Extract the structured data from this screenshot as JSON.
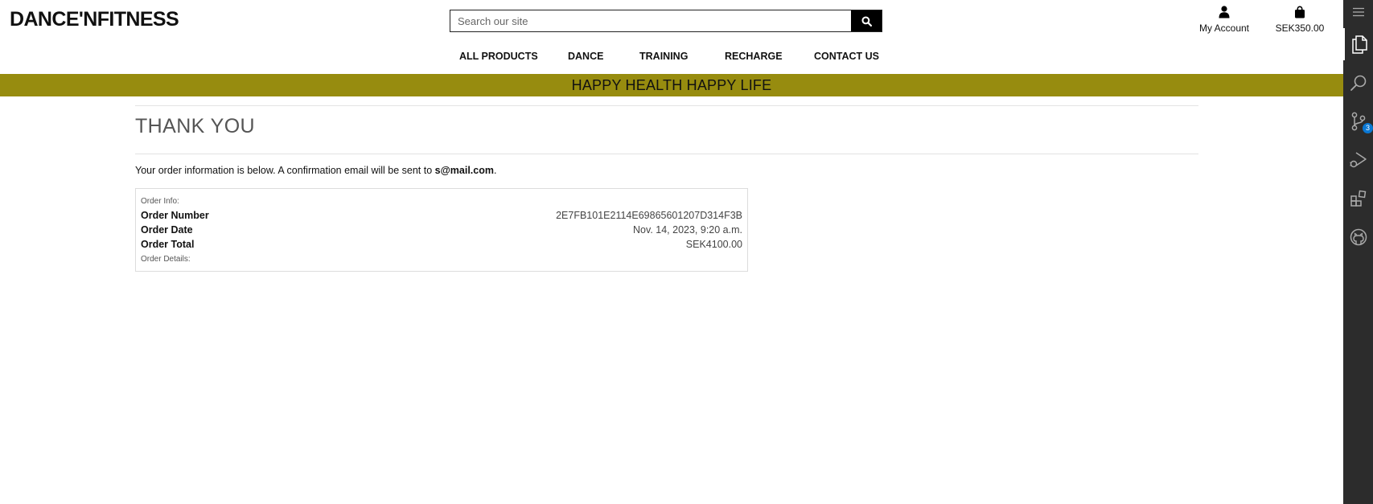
{
  "header": {
    "logo": "DANCE'NFITNESS",
    "search_placeholder": "Search our site",
    "search_button_icon": "search-icon",
    "account_label": "My Account",
    "account_icon": "user-icon",
    "bag_label": "SEK350.00",
    "bag_icon": "shopping-bag-icon"
  },
  "nav": {
    "items": [
      "ALL PRODUCTS",
      "DANCE",
      "TRAINING",
      "RECHARGE",
      "CONTACT US"
    ]
  },
  "banner": {
    "text": "HAPPY HEALTH HAPPY LIFE",
    "background": "#978c0f"
  },
  "main": {
    "title": "THANK YOU",
    "intro_text": "Your order information is below. A confirmation email will be sent to ",
    "intro_email": "s@mail.com",
    "intro_end": ".",
    "order_info_label": "Order Info:",
    "rows": [
      {
        "label": "Order Number",
        "value": "2E7FB101E2114E69865601207D314F3B"
      },
      {
        "label": "Order Date",
        "value": "Nov. 14, 2023, 9:20 a.m."
      },
      {
        "label": "Order Total",
        "value": "SEK4100.00"
      }
    ],
    "order_details_label": "Order Details:"
  },
  "activity_bar": {
    "icons": [
      "menu-icon",
      "explorer-icon",
      "search-icon",
      "source-control-icon",
      "run-debug-icon",
      "extensions-icon",
      "github-icon"
    ],
    "source_control_badge": "3",
    "badge_color": "#0a78d4"
  }
}
